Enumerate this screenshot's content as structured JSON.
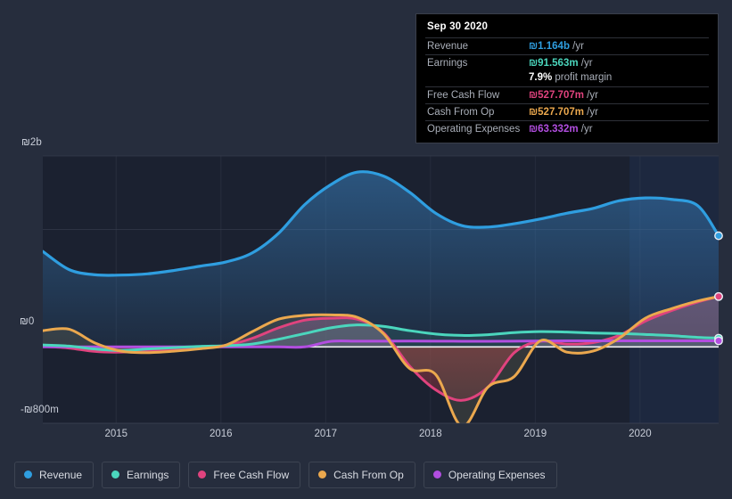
{
  "colors": {
    "background": "#262d3d",
    "plot_background": "#1b2130",
    "forecast_background": "#1d2942",
    "zero_line": "#ffffff",
    "gridline": "#3c4354",
    "axis_text": "#c8cdd8",
    "revenue": "#2f9ee0",
    "earnings": "#4bd6bd",
    "free_cash_flow": "#e0437e",
    "cash_from_op": "#eba84e",
    "operating_expenses": "#b24ee0",
    "tooltip_bg": "#000000",
    "tooltip_border": "#3a3f4b",
    "tooltip_label": "#a9aeb8"
  },
  "tooltip": {
    "date": "Sep 30 2020",
    "rows": [
      {
        "label": "Revenue",
        "value": "₪1.164b",
        "suffix": "/yr",
        "color": "#2f9ee0"
      },
      {
        "label": "Earnings",
        "value": "₪91.563m",
        "suffix": "/yr",
        "color": "#4bd6bd"
      },
      {
        "label": "Free Cash Flow",
        "value": "₪527.707m",
        "suffix": "/yr",
        "color": "#e0437e"
      },
      {
        "label": "Cash From Op",
        "value": "₪527.707m",
        "suffix": "/yr",
        "color": "#eba84e"
      },
      {
        "label": "Operating Expenses",
        "value": "₪63.332m",
        "suffix": "/yr",
        "color": "#b24ee0"
      }
    ],
    "profit_margin_value": "7.9%",
    "profit_margin_label": "profit margin"
  },
  "legend": {
    "items": [
      {
        "label": "Revenue",
        "color": "#2f9ee0"
      },
      {
        "label": "Earnings",
        "color": "#4bd6bd"
      },
      {
        "label": "Free Cash Flow",
        "color": "#e0437e"
      },
      {
        "label": "Cash From Op",
        "color": "#eba84e"
      },
      {
        "label": "Operating Expenses",
        "color": "#b24ee0"
      }
    ]
  },
  "axes": {
    "y_top_label": "₪2b",
    "y_zero_label": "₪0",
    "y_bottom_label": "-₪800m",
    "x_labels": [
      "2015",
      "2016",
      "2017",
      "2018",
      "2019",
      "2020"
    ]
  },
  "chart_data": {
    "type": "area",
    "title": "",
    "subtitle": "",
    "xlabel": "",
    "ylabel": "",
    "currency": "ILS (₪)",
    "ylim": [
      -800000000,
      2000000000
    ],
    "y_ticks": [
      {
        "value": 2000000000,
        "label": "₪2b"
      },
      {
        "value": 0,
        "label": "₪0"
      },
      {
        "value": -800000000,
        "label": "-₪800m"
      }
    ],
    "grid": true,
    "legend_position": "bottom",
    "forecast_start_x": "2019.9",
    "x_ticks": [
      {
        "value": 2015,
        "label": "2015"
      },
      {
        "value": 2016,
        "label": "2016"
      },
      {
        "value": 2017,
        "label": "2017"
      },
      {
        "value": 2018,
        "label": "2018"
      },
      {
        "value": 2019,
        "label": "2019"
      },
      {
        "value": 2020,
        "label": "2020"
      }
    ],
    "x": [
      2014.3,
      2014.55,
      2014.8,
      2015.05,
      2015.3,
      2015.55,
      2015.8,
      2016.05,
      2016.3,
      2016.55,
      2016.8,
      2017.05,
      2017.3,
      2017.55,
      2017.8,
      2018.05,
      2018.3,
      2018.55,
      2018.8,
      2019.05,
      2019.3,
      2019.55,
      2019.8,
      2020.05,
      2020.3,
      2020.55,
      2020.75
    ],
    "series": [
      {
        "name": "Revenue",
        "color": "#2f9ee0",
        "units": "ILS",
        "last_value": 1164000000,
        "values": [
          1000000000,
          810000000,
          755000000,
          752000000,
          765000000,
          800000000,
          845000000,
          890000000,
          985000000,
          1190000000,
          1490000000,
          1700000000,
          1830000000,
          1790000000,
          1620000000,
          1400000000,
          1270000000,
          1255000000,
          1290000000,
          1340000000,
          1400000000,
          1450000000,
          1530000000,
          1560000000,
          1545000000,
          1480000000,
          1164000000
        ]
      },
      {
        "name": "Earnings",
        "color": "#4bd6bd",
        "units": "ILS",
        "last_value": 91563000,
        "values": [
          20000000,
          8000000,
          -22000000,
          -38000000,
          -22000000,
          -8000000,
          5000000,
          12000000,
          30000000,
          80000000,
          140000000,
          200000000,
          230000000,
          215000000,
          170000000,
          135000000,
          120000000,
          128000000,
          150000000,
          160000000,
          155000000,
          145000000,
          140000000,
          130000000,
          118000000,
          100000000,
          91563000
        ]
      },
      {
        "name": "Free Cash Flow",
        "color": "#e0437e",
        "units": "ILS",
        "last_value": 527707000,
        "values": [
          5000000,
          -12000000,
          -48000000,
          -55000000,
          -40000000,
          -25000000,
          -10000000,
          15000000,
          90000000,
          200000000,
          280000000,
          300000000,
          290000000,
          150000000,
          -200000000,
          -450000000,
          -560000000,
          -420000000,
          -60000000,
          60000000,
          30000000,
          45000000,
          120000000,
          270000000,
          380000000,
          470000000,
          527707000
        ]
      },
      {
        "name": "Cash From Op",
        "color": "#eba84e",
        "units": "ILS",
        "last_value": 527707000,
        "values": [
          170000000,
          185000000,
          40000000,
          -45000000,
          -60000000,
          -45000000,
          -20000000,
          20000000,
          160000000,
          290000000,
          330000000,
          335000000,
          310000000,
          140000000,
          -225000000,
          -290000000,
          -830000000,
          -420000000,
          -310000000,
          65000000,
          -55000000,
          -45000000,
          90000000,
          300000000,
          400000000,
          480000000,
          527707000
        ]
      },
      {
        "name": "Operating Expenses",
        "color": "#b24ee0",
        "units": "ILS",
        "last_value": 63332000,
        "values": [
          0,
          0,
          0,
          0,
          0,
          0,
          0,
          0,
          0,
          0,
          0,
          58000000,
          60000000,
          60000000,
          61000000,
          60000000,
          59000000,
          59000000,
          60000000,
          62000000,
          63000000,
          63000000,
          63000000,
          63000000,
          63000000,
          63000000,
          63332000
        ]
      }
    ]
  }
}
